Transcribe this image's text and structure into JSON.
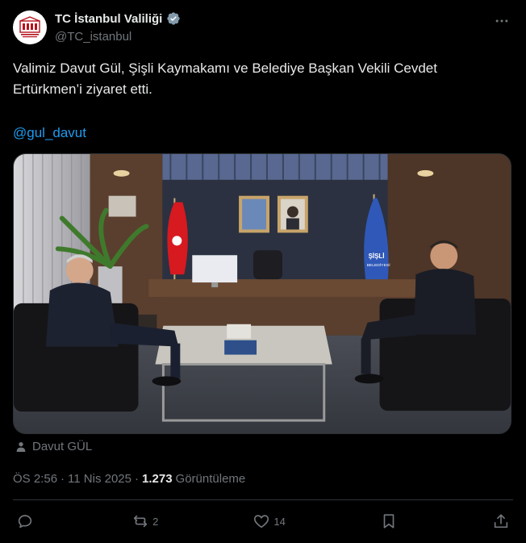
{
  "author": {
    "display_name": "TC İstanbul Valiliği",
    "handle": "@TC_istanbul",
    "avatar_icon": "istanbul-governorship-logo",
    "verified_icon": "verified-badge-icon",
    "verified_color": "#829aab"
  },
  "tweet": {
    "text": "Valimiz Davut Gül, Şişli Kaymakamı ve Belediye Başkan Vekili Cevdet Ertürkmen’i ziyaret etti.",
    "mention": "@gul_davut"
  },
  "media": {
    "flag_text": "ŞİŞLİ",
    "flag_subtext": "BELEDİYESİ"
  },
  "tagged": {
    "icon": "person-icon",
    "name": "Davut GÜL"
  },
  "meta": {
    "time": "ÖS 2:56",
    "separator1": "·",
    "date": "11 Nis 2025",
    "separator2": "·",
    "views_count": "1.273",
    "views_label": "Görüntüleme"
  },
  "actions": {
    "reply_count": "",
    "retweet_count": "2",
    "like_count": "14"
  },
  "colors": {
    "accent": "#1d9bf0",
    "text_primary": "#e7e9ea",
    "text_secondary": "#71767b",
    "divider": "#2f3336",
    "background": "#000000"
  }
}
